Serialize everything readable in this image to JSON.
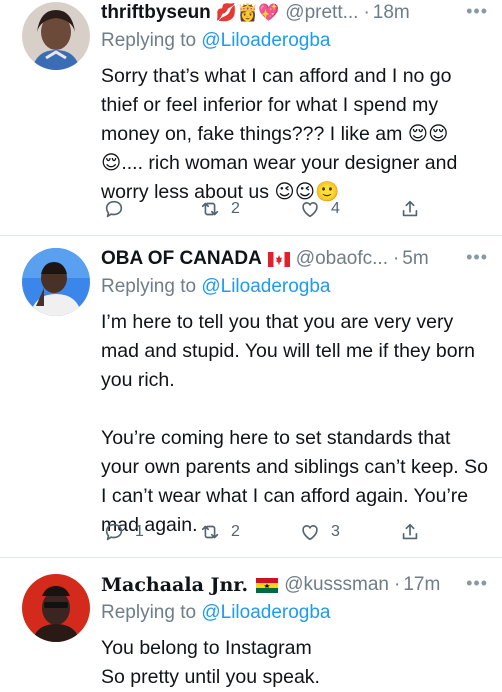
{
  "tweets": [
    {
      "name": "thriftbyseun",
      "name_emojis": "💋👸💖",
      "handle": "@prett...",
      "time": "18m",
      "replying_prefix": "Replying to ",
      "replying_to": "@Liloaderogba",
      "text": "Sorry that’s what I can afford and I no go thief or feel inferior for what I spend my money on, fake things??? I like am 😌😌 😌.... rich woman wear your designer and worry less about us 😉😉🙂",
      "replies": "",
      "retweets": "2",
      "likes": "4",
      "avatar_colors": [
        "#3a2a25",
        "#e8e0d8"
      ]
    },
    {
      "name": "OBA OF CANADA",
      "name_emojis": "",
      "handle": "@obaofc...",
      "time": "5m",
      "replying_prefix": "Replying to ",
      "replying_to": "@Liloaderogba",
      "text": "I’m here to tell you that you are very very mad and stupid. You will tell me if they born you rich.\n\nYou’re coming here to set standards that your own parents and siblings can’t keep. So I can’t wear what I can afford again. You’re mad again.",
      "replies": "1",
      "retweets": "2",
      "likes": "3",
      "avatar_colors": [
        "#2e7ce8",
        "#5a3f35"
      ]
    },
    {
      "name": "Machaala Jnr.",
      "name_emojis": "",
      "handle": "@kusssman",
      "time": "17m",
      "replying_prefix": "Replying to ",
      "replying_to": "@Liloaderogba",
      "text": "You belong to Instagram\nSo pretty until you speak.",
      "avatar_colors": [
        "#d42a1c",
        "#3a2520"
      ]
    }
  ],
  "more_glyph": "•••",
  "dot_glyph": "·",
  "icons": [
    "reply-icon",
    "retweet-icon",
    "like-icon",
    "share-icon",
    "canada-flag-icon",
    "ghana-flag-icon",
    "more-icon"
  ]
}
